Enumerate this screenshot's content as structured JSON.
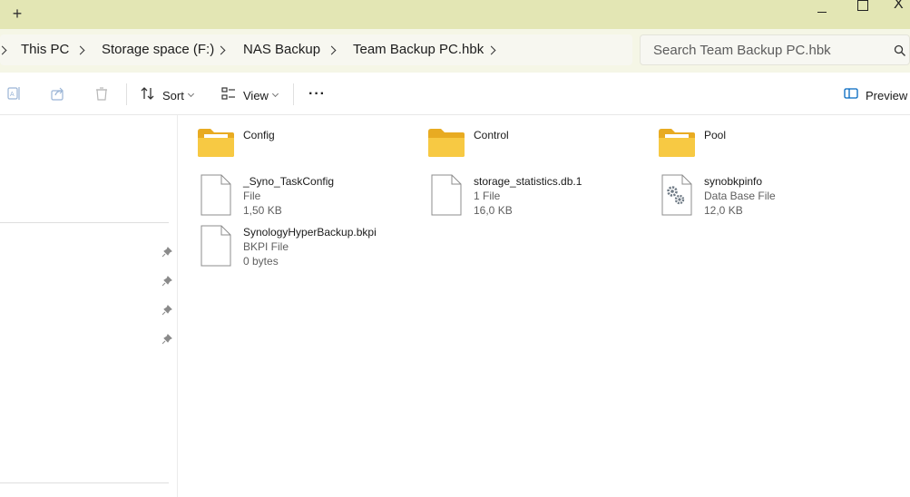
{
  "titlebar": {
    "new_tab": "+",
    "close": "X"
  },
  "address": {
    "breadcrumbs": [
      "This PC",
      "Storage space (F:)",
      "NAS Backup",
      "Team Backup PC.hbk"
    ]
  },
  "search": {
    "placeholder": "Search Team Backup PC.hbk",
    "icon": "search-icon"
  },
  "commandbar": {
    "sort_label": "Sort",
    "view_label": "View",
    "more_label": "···",
    "preview_label": "Preview"
  },
  "colors": {
    "titlebar": "#e3e6b4",
    "folder": "#f7c943",
    "accent": "#0067c0"
  },
  "items": {
    "folders": [
      {
        "name": "Config"
      },
      {
        "name": "Control"
      },
      {
        "name": "Pool"
      }
    ],
    "files": [
      {
        "name": "_Syno_TaskConfig",
        "type": "File",
        "size": "1,50 KB",
        "icon": "file-icon"
      },
      {
        "name": "storage_statistics.db.1",
        "type": "1 File",
        "size": "16,0 KB",
        "icon": "file-icon"
      },
      {
        "name": "synobkpinfo",
        "type": "Data Base File",
        "size": "12,0 KB",
        "icon": "settings-file-icon"
      },
      {
        "name": "SynologyHyperBackup.bkpi",
        "type": "BKPI File",
        "size": "0 bytes",
        "icon": "file-icon"
      }
    ]
  }
}
